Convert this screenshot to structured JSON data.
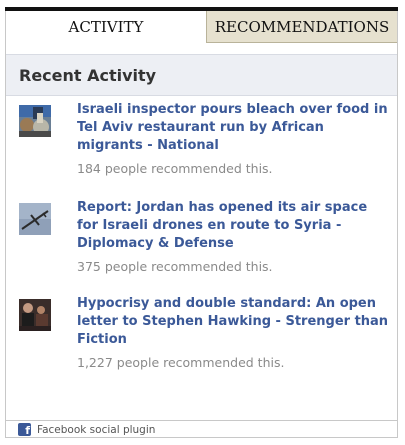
{
  "tabs": {
    "activity_label": "ACTIVITY",
    "recommendations_label": "RECOMMENDATIONS"
  },
  "header": {
    "title": "Recent Activity"
  },
  "items": [
    {
      "title": "Israeli inspector pours bleach over food in Tel Aviv restaurant run by African migrants - National",
      "count_text": "184 people recommended this."
    },
    {
      "title": "Report: Jordan has opened its air space for Israeli drones en route to Syria - Diplomacy & Defense",
      "count_text": "375 people recommended this."
    },
    {
      "title": "Hypocrisy and double standard: An open letter to Stephen Hawking - Strenger than Fiction",
      "count_text": "1,227 people recommended this."
    }
  ],
  "footer": {
    "icon_glyph": "f",
    "label": "Facebook social plugin"
  },
  "colors": {
    "link": "#3b5998",
    "muted": "#8a8a8a",
    "header_bg": "#edeff4",
    "tab_inactive_bg": "#e6e1cf"
  }
}
